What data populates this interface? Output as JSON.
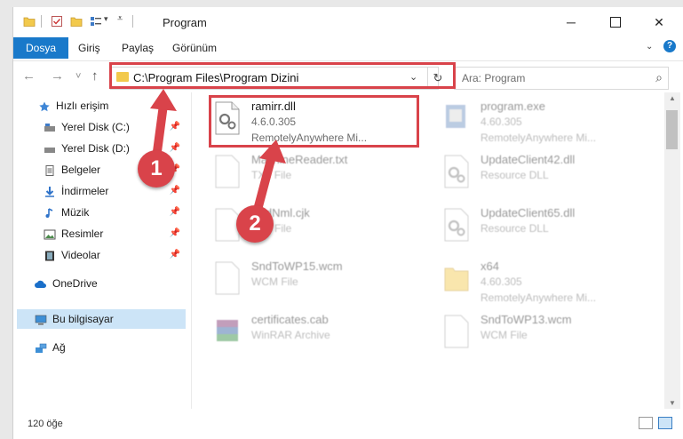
{
  "window": {
    "title": "Program"
  },
  "ribbon": {
    "tabs": [
      "Dosya",
      "Giriş",
      "Paylaş",
      "Görünüm"
    ]
  },
  "nav": {
    "back": "←",
    "forward": "→",
    "recent": "˅",
    "up": "↑"
  },
  "address": {
    "path": "C:\\Program Files\\Program Dizini",
    "dropdown": "⌄",
    "refresh": "↻"
  },
  "search": {
    "placeholder": "Ara: Program",
    "icon": "⌕"
  },
  "sidebar": {
    "items": [
      {
        "label": "Hızlı erişim",
        "icon": "star-icon"
      },
      {
        "label": "Yerel Disk (C:)",
        "icon": "drive-icon",
        "pinned": true
      },
      {
        "label": "Yerel Disk (D:)",
        "icon": "drive-icon",
        "pinned": true
      },
      {
        "label": "Belgeler",
        "icon": "documents-icon",
        "pinned": true
      },
      {
        "label": "İndirmeler",
        "icon": "download-icon",
        "pinned": true
      },
      {
        "label": "Müzik",
        "icon": "music-icon",
        "pinned": true
      },
      {
        "label": "Resimler",
        "icon": "pictures-icon",
        "pinned": true
      },
      {
        "label": "Videolar",
        "icon": "videos-icon",
        "pinned": true
      },
      {
        "label": "OneDrive",
        "icon": "cloud-icon"
      },
      {
        "label": "Bu bilgisayar",
        "icon": "computer-icon",
        "selected": true
      },
      {
        "label": "Ağ",
        "icon": "network-icon"
      }
    ]
  },
  "files": [
    {
      "name": "ramirr.dll",
      "line2": "4.6.0.305",
      "line3": "RemotelyAnywhere Mi...",
      "icon": "dll-gear-icon",
      "highlighted": true
    },
    {
      "name": "program.exe",
      "line2": "4.60.305",
      "line3": "RemotelyAnywhere Mi...",
      "icon": "exe-icon"
    },
    {
      "name": "MachineReader.txt",
      "line2": "TXT File",
      "line3": "",
      "icon": "text-file-icon"
    },
    {
      "name": "UpdateClient42.dll",
      "line2": "Resource DLL",
      "line3": "",
      "icon": "dll-gear-icon"
    },
    {
      "name": "SndNml.cjk",
      "line2": "CJK File",
      "line3": "",
      "icon": "blank-file-icon"
    },
    {
      "name": "UpdateClient65.dll",
      "line2": "Resource DLL",
      "line3": "",
      "icon": "dll-gear-icon"
    },
    {
      "name": "SndToWP15.wcm",
      "line2": "WCM File",
      "line3": "",
      "icon": "blank-file-icon"
    },
    {
      "name": "x64",
      "line2": "4.60.305",
      "line3": "RemotelyAnywhere Mi...",
      "icon": "folder-icon"
    },
    {
      "name": "certificates.cab",
      "line2": "WinRAR Archive",
      "line3": "",
      "icon": "winrar-icon"
    },
    {
      "name": "SndToWP13.wcm",
      "line2": "WCM File",
      "line3": "",
      "icon": "blank-file-icon"
    }
  ],
  "status": {
    "count": "120 öğe"
  },
  "callouts": [
    "1",
    "2"
  ],
  "colors": {
    "accent": "#1979ca",
    "highlight": "#d9434a",
    "selected_bg": "#cce4f7"
  }
}
